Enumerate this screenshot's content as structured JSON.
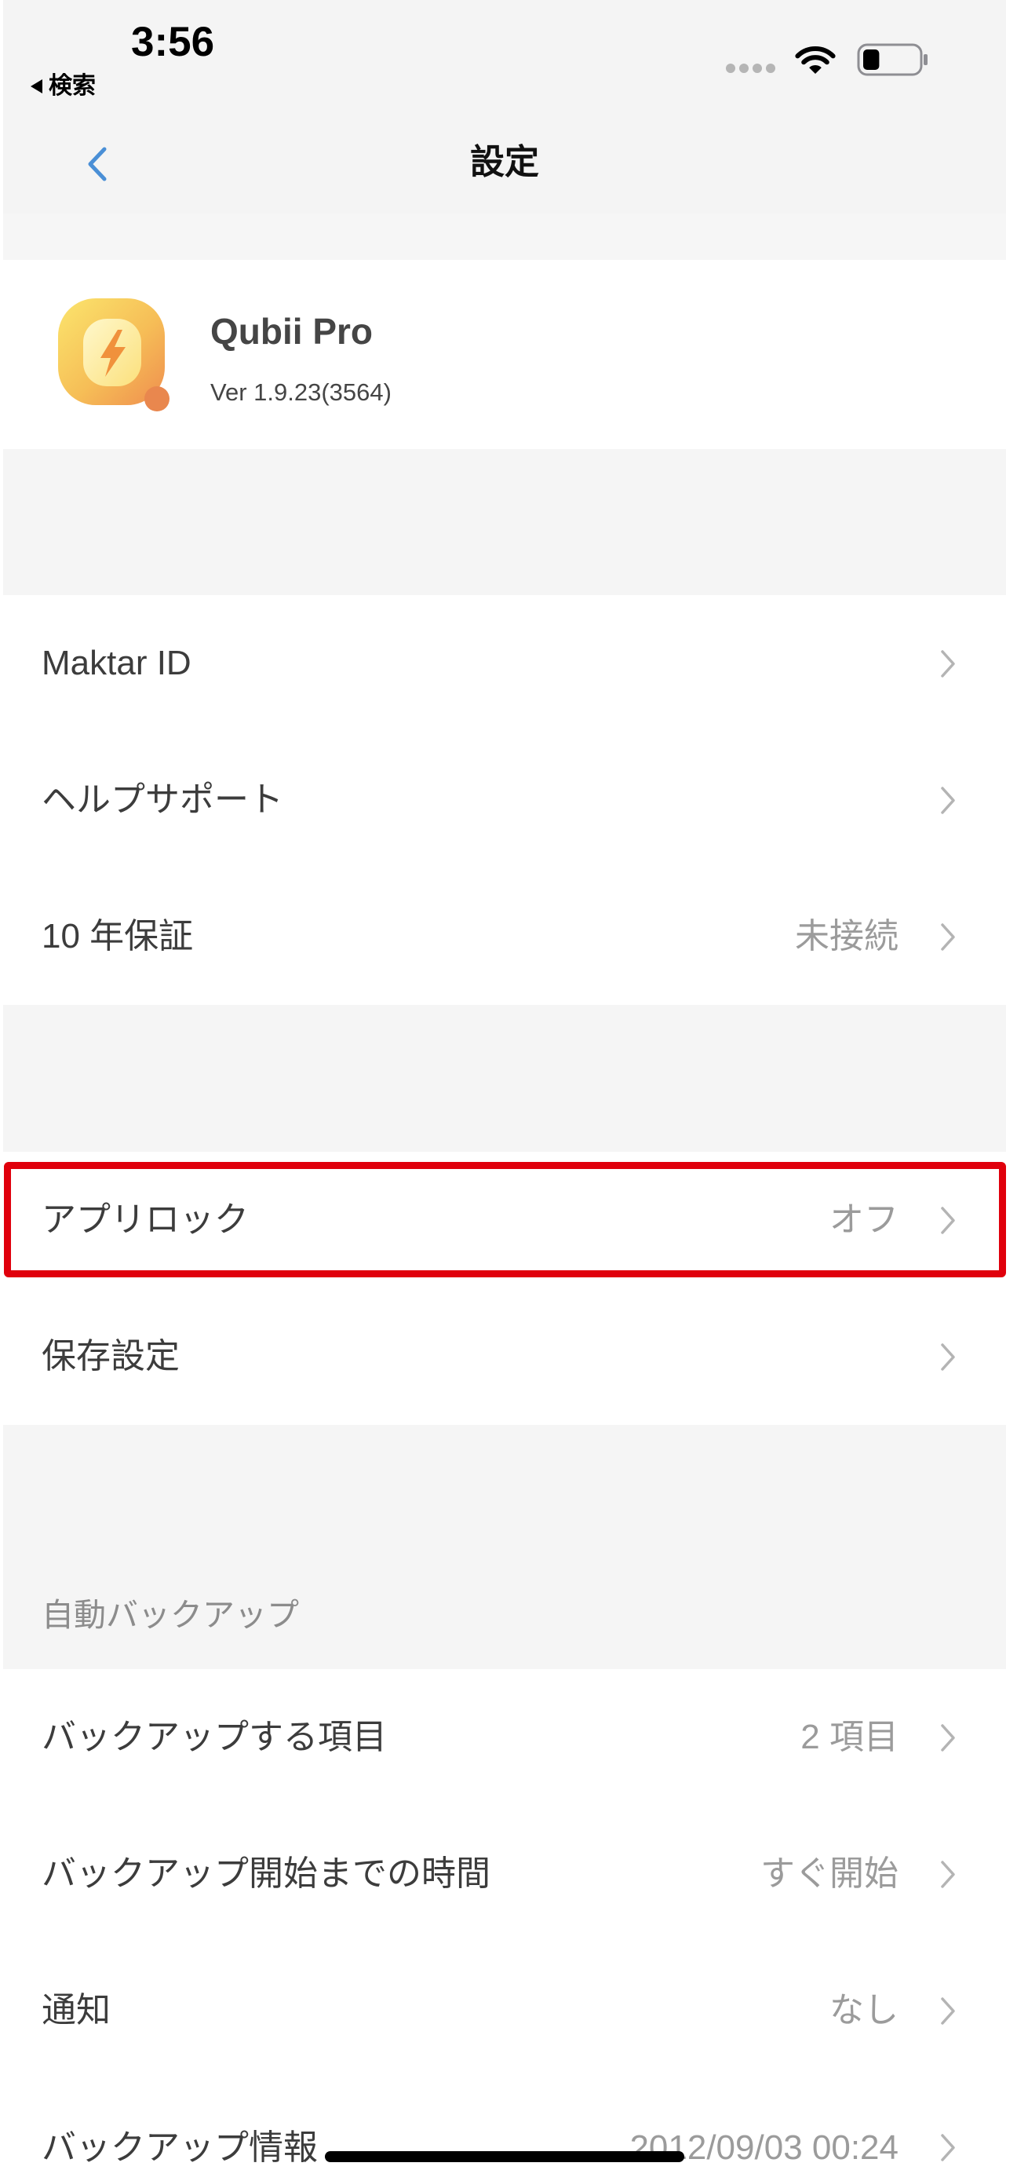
{
  "status_bar": {
    "time": "3:56",
    "back_app_label": "検索",
    "back_app_icon": "back-to-app-triangle-icon",
    "signal_icon": "signal-dots-icon",
    "wifi_icon": "wifi-icon",
    "battery_icon": "battery-icon",
    "battery_level": 0.3
  },
  "nav": {
    "title": "設定",
    "back_icon": "chevron-left-icon"
  },
  "app_info": {
    "icon": "qubii-app-icon",
    "name": "Qubii Pro",
    "version": "Ver 1.9.23(3564)"
  },
  "section_account": {
    "items": [
      {
        "label": "Maktar ID"
      },
      {
        "label": "ヘルプサポート"
      },
      {
        "label": "10 年保証",
        "value": "未接続"
      }
    ]
  },
  "section_security": {
    "items": [
      {
        "label": "アプリロック",
        "value": "オフ",
        "highlighted": true
      },
      {
        "label": "保存設定"
      }
    ]
  },
  "section_backup": {
    "header": "自動バックアップ",
    "items": [
      {
        "label": "バックアップする項目",
        "value": "2 項目"
      },
      {
        "label": "バックアップ開始までの時間",
        "value": "すぐ開始"
      },
      {
        "label": "通知",
        "value": "なし"
      },
      {
        "label": "バックアップ情報",
        "value": "2012/09/03 00:24"
      }
    ]
  },
  "row_icon": "chevron-right-icon",
  "colors": {
    "accent": "#4a8fd6",
    "highlight": "#e0000c",
    "background": "#f5f5f5"
  }
}
